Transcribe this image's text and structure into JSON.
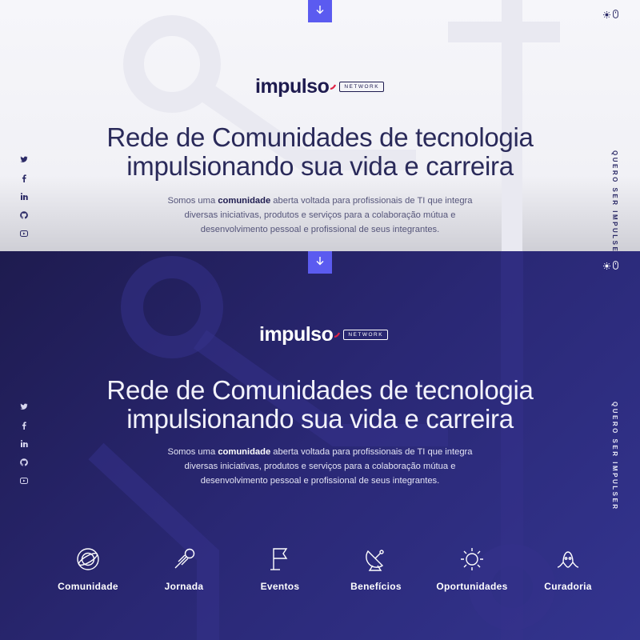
{
  "colors": {
    "accent": "#5b5bf0",
    "navy": "#1e1b4f",
    "dark_bg_start": "#1e1b4f",
    "dark_bg_end": "#33348f",
    "light_bg": "#f4f4f8"
  },
  "icons": {
    "scroll": "arrow-down-icon",
    "theme": [
      "sun-icon",
      "mouse-icon"
    ],
    "social": [
      "twitter-icon",
      "facebook-icon",
      "linkedin-icon",
      "github-icon",
      "youtube-icon"
    ]
  },
  "light": {
    "logo_word": "impulso",
    "logo_tag": "NETWORK",
    "headline_line1": "Rede de Comunidades de tecnologia",
    "headline_line2": "impulsionando sua vida e carreira",
    "desc_part1": "Somos uma ",
    "desc_bold": "comunidade",
    "desc_part2": " aberta voltada para profissionais de TI que integra",
    "desc_line2": "diversas iniciativas, produtos e serviços para a colaboração mútua e",
    "desc_line3": "desenvolvimento pessoal e profissional de seus integrantes.",
    "cta": "QUERO SER IMPULSER"
  },
  "dark": {
    "logo_word": "impulso",
    "logo_tag": "NETWORK",
    "headline_line1": "Rede de Comunidades de tecnologia",
    "headline_line2": "impulsionando sua vida e carreira",
    "desc_part1": "Somos uma ",
    "desc_bold": "comunidade",
    "desc_part2": " aberta voltada para profissionais de TI que integra",
    "desc_line2": "diversas iniciativas, produtos e serviços para a colaboração mútua e",
    "desc_line3": "desenvolvimento pessoal e profissional de seus integrantes.",
    "cta": "QUERO SER IMPULSER",
    "features": [
      {
        "label": "Comunidade",
        "icon": "planet-icon"
      },
      {
        "label": "Jornada",
        "icon": "comet-icon"
      },
      {
        "label": "Eventos",
        "icon": "flag-icon"
      },
      {
        "label": "Benefícios",
        "icon": "satellite-dish-icon"
      },
      {
        "label": "Oportunidades",
        "icon": "sun-rays-icon"
      },
      {
        "label": "Curadoria",
        "icon": "alien-icon"
      }
    ]
  }
}
